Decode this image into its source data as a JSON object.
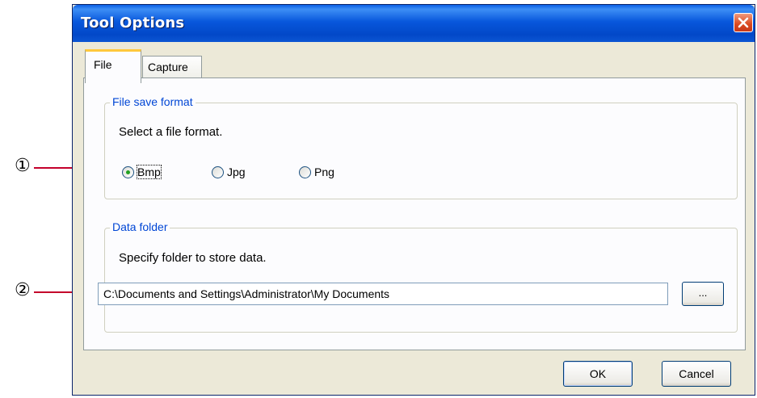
{
  "window": {
    "title": "Tool Options"
  },
  "tabs": [
    {
      "label": "File",
      "selected": true
    },
    {
      "label": "Capture",
      "selected": false
    }
  ],
  "file_save_format": {
    "legend": "File save format",
    "instruction": "Select a file format.",
    "options": [
      {
        "label": "Bmp",
        "selected": true
      },
      {
        "label": "Jpg",
        "selected": false
      },
      {
        "label": "Png",
        "selected": false
      }
    ]
  },
  "data_folder": {
    "legend": "Data folder",
    "instruction": "Specify folder to store data.",
    "path": "C:\\Documents and Settings\\Administrator\\My Documents",
    "browse_label": "..."
  },
  "buttons": {
    "ok": "OK",
    "cancel": "Cancel"
  },
  "callouts": [
    "①",
    "②"
  ],
  "colors": {
    "title_bar": "#0857dc",
    "accent_legend": "#0046d5",
    "callout_line": "#c4002b",
    "radio_selected": "#21a121"
  }
}
